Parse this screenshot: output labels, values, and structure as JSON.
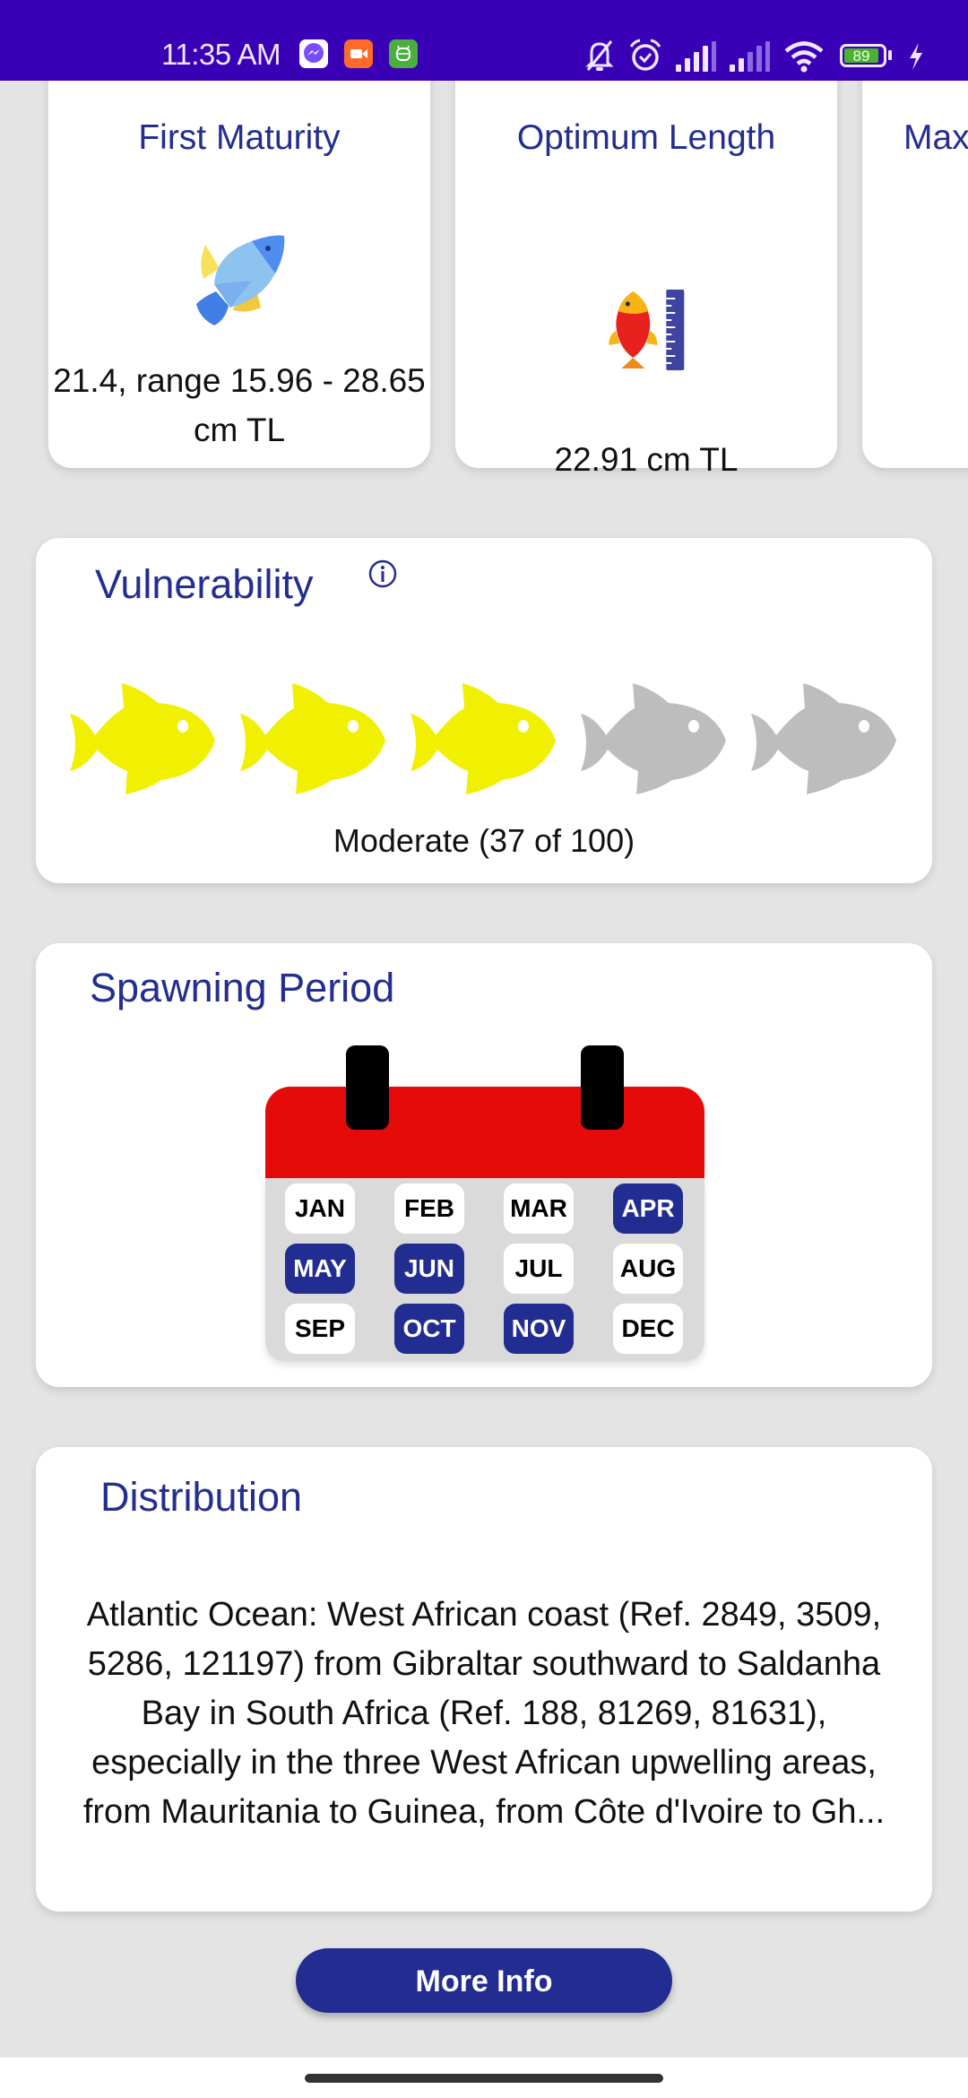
{
  "status_bar": {
    "time": "11:35 AM",
    "notification_icons": [
      "messenger-icon",
      "video-recorder-icon",
      "android-app-icon"
    ],
    "system_icons": [
      "bell-muted-icon",
      "alarm-icon",
      "signal-1-icon",
      "signal-2-icon",
      "wifi-icon",
      "battery-icon",
      "charging-icon"
    ],
    "battery_level": "89"
  },
  "stats": [
    {
      "title": "First Maturity",
      "icon": "blue-fish-icon",
      "value": "21.4, range 15.96 - 28.65 cm TL"
    },
    {
      "title": "Optimum Length",
      "icon": "fish-ruler-icon",
      "value": "22.91 cm TL"
    },
    {
      "title": "Max",
      "value": ""
    }
  ],
  "vulnerability": {
    "title": "Vulnerability",
    "rating_text": "Moderate (37 of 100)",
    "score": 37,
    "max_score": 100,
    "fish_filled": 3,
    "fish_total": 5,
    "colors": {
      "filled": "#f0f000",
      "empty": "#bdbdbd"
    }
  },
  "spawning": {
    "title": "Spawning Period",
    "months": [
      {
        "label": "JAN",
        "active": false
      },
      {
        "label": "FEB",
        "active": false
      },
      {
        "label": "MAR",
        "active": false
      },
      {
        "label": "APR",
        "active": true
      },
      {
        "label": "MAY",
        "active": true
      },
      {
        "label": "JUN",
        "active": true
      },
      {
        "label": "JUL",
        "active": false
      },
      {
        "label": "AUG",
        "active": false
      },
      {
        "label": "SEP",
        "active": false
      },
      {
        "label": "OCT",
        "active": true
      },
      {
        "label": "NOV",
        "active": true
      },
      {
        "label": "DEC",
        "active": false
      }
    ]
  },
  "distribution": {
    "title": "Distribution",
    "text": "Atlantic Ocean: West African coast (Ref. 2849, 3509, 5286, 121197) from Gibraltar southward to Saldanha Bay in South Africa (Ref. 188, 81269, 81631), especially in the three West African upwelling areas, from Mauritania to Guinea, from Côte d'Ivoire to Gh..."
  },
  "more_info_button": "More Info",
  "colors": {
    "status_bar": "#3a00b6",
    "accent": "#222c91",
    "title": "#232e8f",
    "calendar_red": "#e60b0b"
  }
}
